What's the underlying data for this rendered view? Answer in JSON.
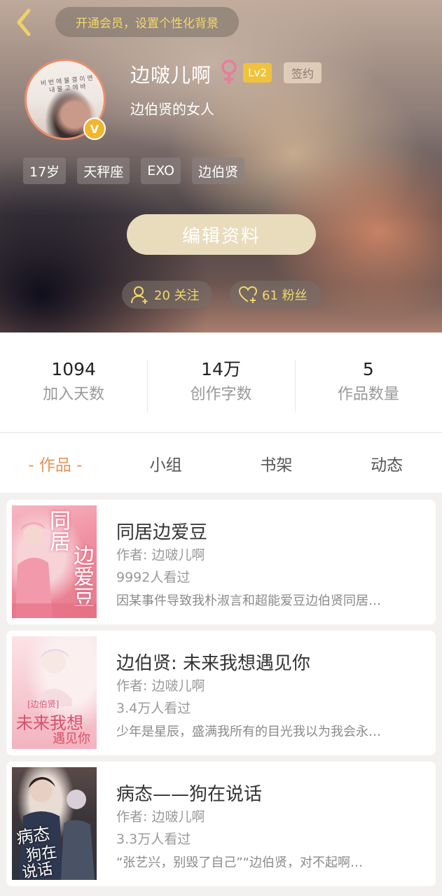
{
  "header": {
    "vip_banner": "开通会员，设置个性化背景",
    "profile": {
      "username": "边啵儿啊",
      "level": "Lv2",
      "sign_badge": "签约",
      "signature": "边伯贤的女人",
      "avatar_badge": "V"
    },
    "tags": [
      "17岁",
      "天秤座",
      "EXO",
      "边伯贤"
    ],
    "edit_button": "编辑资料",
    "following": "20 关注",
    "fans": "61 粉丝"
  },
  "stats": [
    {
      "value": "1094",
      "label": "加入天数"
    },
    {
      "value": "14万",
      "label": "创作字数"
    },
    {
      "value": "5",
      "label": "作品数量"
    }
  ],
  "tabs": [
    {
      "label": "- 作品 -",
      "active": true
    },
    {
      "label": "小组",
      "active": false
    },
    {
      "label": "书架",
      "active": false
    },
    {
      "label": "动态",
      "active": false
    }
  ],
  "works": [
    {
      "title": "同居边爱豆",
      "author": "作者: 边啵儿啊",
      "views": "9992人看过",
      "desc": "因某事件导致我朴淑言和超能爱豆边伯贤同居…"
    },
    {
      "title": "边伯贤: 未来我想遇见你",
      "author": "作者: 边啵儿啊",
      "views": "3.4万人看过",
      "desc": "少年是星辰，盛满我所有的目光我以为我会永…"
    },
    {
      "title": "病态——狗在说话",
      "author": "作者: 边啵儿啊",
      "views": "3.3万人看过",
      "desc": "“张艺兴，别毁了自己”“边伯贤，对不起啊…"
    }
  ],
  "colors": {
    "accent": "#e89157",
    "vip_text": "#f1d96a",
    "level_badge": "#f0c23d",
    "edit_button": "#e8dcbc"
  }
}
